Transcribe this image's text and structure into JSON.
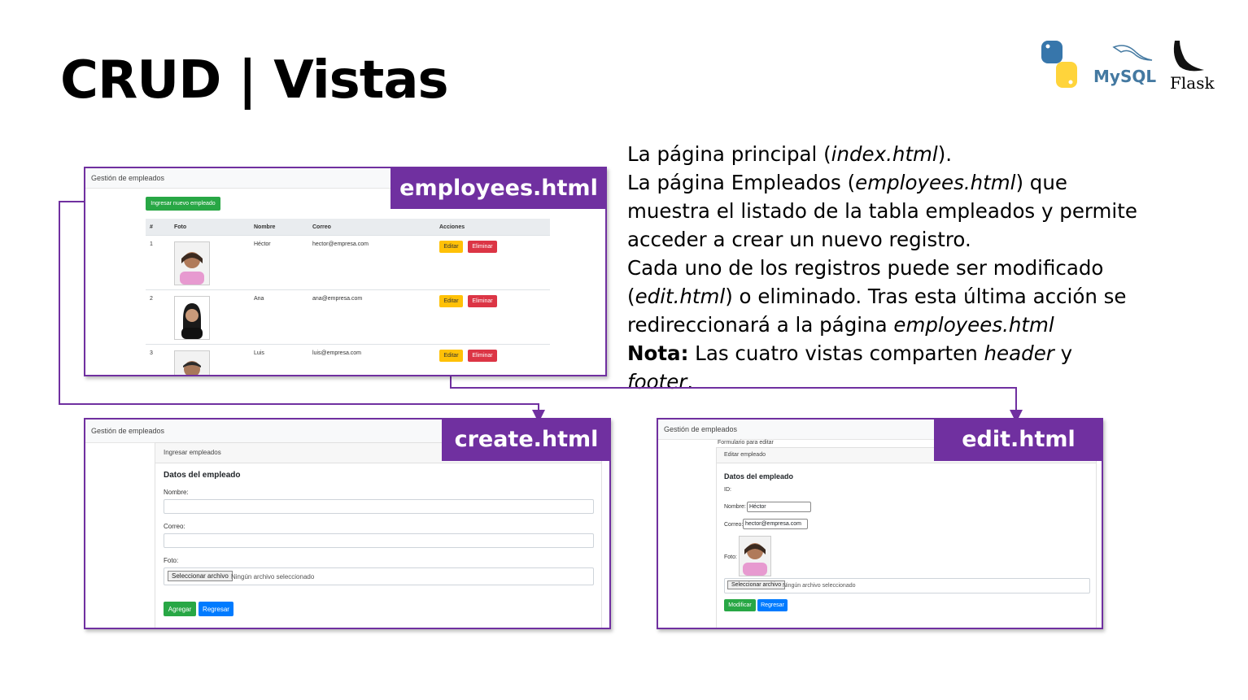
{
  "slide": {
    "title": "CRUD | Vistas",
    "desc_parts": {
      "p1_a": "La página principal (",
      "p1_b": "index.html",
      "p1_c": ").",
      "p2_a": "La página Empleados (",
      "p2_b": "employees.html",
      "p2_c": ") que muestra el listado de la tabla empleados y permite acceder a crear un nuevo registro.",
      "p3_a": "Cada uno de los registros puede ser modificado (",
      "p3_b": "edit.html",
      "p3_c": ") o eliminado. Tras esta última acción se redireccionará a la página ",
      "p3_d": "employees.html",
      "p4_a": "Nota:",
      "p4_b": " Las cuatro vistas comparten ",
      "p4_c": "header",
      "p4_d": " y ",
      "p4_e": "footer",
      "p4_f": "."
    },
    "logos": {
      "mysql": "MySQL",
      "flask": "Flask"
    },
    "colors": {
      "accent": "#7030a0"
    }
  },
  "employees_view": {
    "tag": "employees.html",
    "navbar": "Gestión de empleados",
    "new_button": "Ingresar nuevo empleado",
    "headers": [
      "#",
      "Foto",
      "Nombre",
      "Correo",
      "Acciones"
    ],
    "rows": [
      {
        "id": "1",
        "name": "Héctor",
        "email": "hector@empresa.com"
      },
      {
        "id": "2",
        "name": "Ana",
        "email": "ana@empresa.com"
      },
      {
        "id": "3",
        "name": "Luis",
        "email": "luis@empresa.com"
      }
    ],
    "edit_label": "Editar",
    "delete_label": "Eliminar"
  },
  "create_view": {
    "tag": "create.html",
    "navbar": "Gestión de empleados",
    "card_header": "Ingresar empleados",
    "card_title": "Datos del empleado",
    "name_label": "Nombre:",
    "email_label": "Correo:",
    "photo_label": "Foto:",
    "file_button": "Seleccionar archivo",
    "file_none": "Ningún archivo seleccionado",
    "add_button": "Agregar",
    "back_button": "Regresar"
  },
  "edit_view": {
    "tag": "edit.html",
    "navbar": "Gestión de empleados",
    "form_caption": "Formulario para editar",
    "card_header": "Editar empleado",
    "card_title": "Datos del empleado",
    "id_label": "ID:",
    "name_label": "Nombre:",
    "name_value": "Héctor",
    "email_label": "Correo:",
    "email_value": "hector@empresa.com",
    "photo_label": "Foto:",
    "file_button": "Seleccionar archivo",
    "file_none": "Ningún archivo seleccionado",
    "modify_button": "Modificar",
    "back_button": "Regresar"
  }
}
